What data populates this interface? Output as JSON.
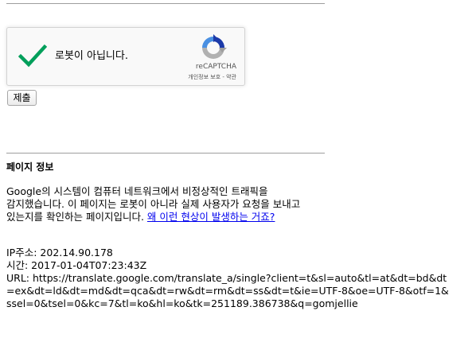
{
  "recaptcha": {
    "checkbox_label": "로봇이 아닙니다.",
    "brand": "reCAPTCHA",
    "privacy_terms": "개인정보 보호 - 약관",
    "check_color": "#029f5b",
    "logo_colors": [
      "#1c3aa9",
      "#4a90e2",
      "#b1b1b1"
    ]
  },
  "form": {
    "submit_label": "제출"
  },
  "info": {
    "heading": "페이지 정보",
    "paragraph": "Google의 시스템이 컴퓨터 네트워크에서 비정상적인 트래픽을 감지했습니다. 이 페이지는 로봇이 아니라 실제 사용자가 요청을 보내고 있는지를 확인하는 페이지입니다.",
    "why_link": "왜 이런 현상이 발생하는 거죠?",
    "link_color": "#0000ee"
  },
  "details": {
    "ip": "IP주소: 202.14.90.178",
    "time": "시간: 2017-01-04T07:23:43Z",
    "url": "URL: https://translate.google.com/translate_a/single?client=t&sl=auto&tl=at&dt=bd&dt=ex&dt=ld&dt=md&dt=qca&dt=rw&dt=rm&dt=ss&dt=t&ie=UTF-8&oe=UTF-8&otf=1&ssel=0&tsel=0&kc=7&tl=ko&hl=ko&tk=251189.386738&q=gomjellie"
  }
}
